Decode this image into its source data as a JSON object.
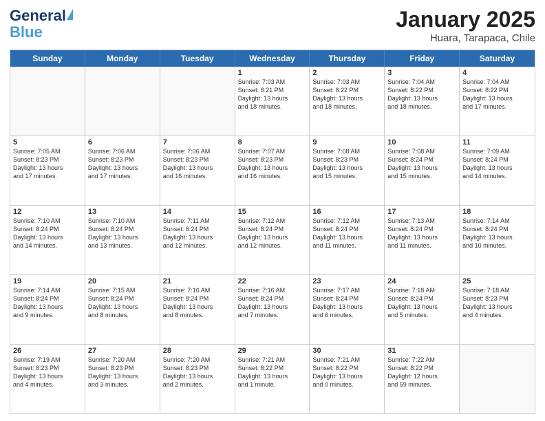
{
  "header": {
    "logo_general": "General",
    "logo_blue": "Blue",
    "month_year": "January 2025",
    "location": "Huara, Tarapaca, Chile"
  },
  "weekdays": [
    "Sunday",
    "Monday",
    "Tuesday",
    "Wednesday",
    "Thursday",
    "Friday",
    "Saturday"
  ],
  "rows": [
    [
      {
        "day": "",
        "text": ""
      },
      {
        "day": "",
        "text": ""
      },
      {
        "day": "",
        "text": ""
      },
      {
        "day": "1",
        "text": "Sunrise: 7:03 AM\nSunset: 8:21 PM\nDaylight: 13 hours\nand 18 minutes."
      },
      {
        "day": "2",
        "text": "Sunrise: 7:03 AM\nSunset: 8:22 PM\nDaylight: 13 hours\nand 18 minutes."
      },
      {
        "day": "3",
        "text": "Sunrise: 7:04 AM\nSunset: 8:22 PM\nDaylight: 13 hours\nand 18 minutes."
      },
      {
        "day": "4",
        "text": "Sunrise: 7:04 AM\nSunset: 8:22 PM\nDaylight: 13 hours\nand 17 minutes."
      }
    ],
    [
      {
        "day": "5",
        "text": "Sunrise: 7:05 AM\nSunset: 8:23 PM\nDaylight: 13 hours\nand 17 minutes."
      },
      {
        "day": "6",
        "text": "Sunrise: 7:06 AM\nSunset: 8:23 PM\nDaylight: 13 hours\nand 17 minutes."
      },
      {
        "day": "7",
        "text": "Sunrise: 7:06 AM\nSunset: 8:23 PM\nDaylight: 13 hours\nand 16 minutes."
      },
      {
        "day": "8",
        "text": "Sunrise: 7:07 AM\nSunset: 8:23 PM\nDaylight: 13 hours\nand 16 minutes."
      },
      {
        "day": "9",
        "text": "Sunrise: 7:08 AM\nSunset: 8:23 PM\nDaylight: 13 hours\nand 15 minutes."
      },
      {
        "day": "10",
        "text": "Sunrise: 7:08 AM\nSunset: 8:24 PM\nDaylight: 13 hours\nand 15 minutes."
      },
      {
        "day": "11",
        "text": "Sunrise: 7:09 AM\nSunset: 8:24 PM\nDaylight: 13 hours\nand 14 minutes."
      }
    ],
    [
      {
        "day": "12",
        "text": "Sunrise: 7:10 AM\nSunset: 8:24 PM\nDaylight: 13 hours\nand 14 minutes."
      },
      {
        "day": "13",
        "text": "Sunrise: 7:10 AM\nSunset: 8:24 PM\nDaylight: 13 hours\nand 13 minutes."
      },
      {
        "day": "14",
        "text": "Sunrise: 7:11 AM\nSunset: 8:24 PM\nDaylight: 13 hours\nand 12 minutes."
      },
      {
        "day": "15",
        "text": "Sunrise: 7:12 AM\nSunset: 8:24 PM\nDaylight: 13 hours\nand 12 minutes."
      },
      {
        "day": "16",
        "text": "Sunrise: 7:12 AM\nSunset: 8:24 PM\nDaylight: 13 hours\nand 11 minutes."
      },
      {
        "day": "17",
        "text": "Sunrise: 7:13 AM\nSunset: 8:24 PM\nDaylight: 13 hours\nand 11 minutes."
      },
      {
        "day": "18",
        "text": "Sunrise: 7:14 AM\nSunset: 8:24 PM\nDaylight: 13 hours\nand 10 minutes."
      }
    ],
    [
      {
        "day": "19",
        "text": "Sunrise: 7:14 AM\nSunset: 8:24 PM\nDaylight: 13 hours\nand 9 minutes."
      },
      {
        "day": "20",
        "text": "Sunrise: 7:15 AM\nSunset: 8:24 PM\nDaylight: 13 hours\nand 8 minutes."
      },
      {
        "day": "21",
        "text": "Sunrise: 7:16 AM\nSunset: 8:24 PM\nDaylight: 13 hours\nand 8 minutes."
      },
      {
        "day": "22",
        "text": "Sunrise: 7:16 AM\nSunset: 8:24 PM\nDaylight: 13 hours\nand 7 minutes."
      },
      {
        "day": "23",
        "text": "Sunrise: 7:17 AM\nSunset: 8:24 PM\nDaylight: 13 hours\nand 6 minutes."
      },
      {
        "day": "24",
        "text": "Sunrise: 7:18 AM\nSunset: 8:24 PM\nDaylight: 13 hours\nand 5 minutes."
      },
      {
        "day": "25",
        "text": "Sunrise: 7:18 AM\nSunset: 8:23 PM\nDaylight: 13 hours\nand 4 minutes."
      }
    ],
    [
      {
        "day": "26",
        "text": "Sunrise: 7:19 AM\nSunset: 8:23 PM\nDaylight: 13 hours\nand 4 minutes."
      },
      {
        "day": "27",
        "text": "Sunrise: 7:20 AM\nSunset: 8:23 PM\nDaylight: 13 hours\nand 3 minutes."
      },
      {
        "day": "28",
        "text": "Sunrise: 7:20 AM\nSunset: 8:23 PM\nDaylight: 13 hours\nand 2 minutes."
      },
      {
        "day": "29",
        "text": "Sunrise: 7:21 AM\nSunset: 8:22 PM\nDaylight: 13 hours\nand 1 minute."
      },
      {
        "day": "30",
        "text": "Sunrise: 7:21 AM\nSunset: 8:22 PM\nDaylight: 13 hours\nand 0 minutes."
      },
      {
        "day": "31",
        "text": "Sunrise: 7:22 AM\nSunset: 8:22 PM\nDaylight: 12 hours\nand 59 minutes."
      },
      {
        "day": "",
        "text": ""
      }
    ]
  ]
}
